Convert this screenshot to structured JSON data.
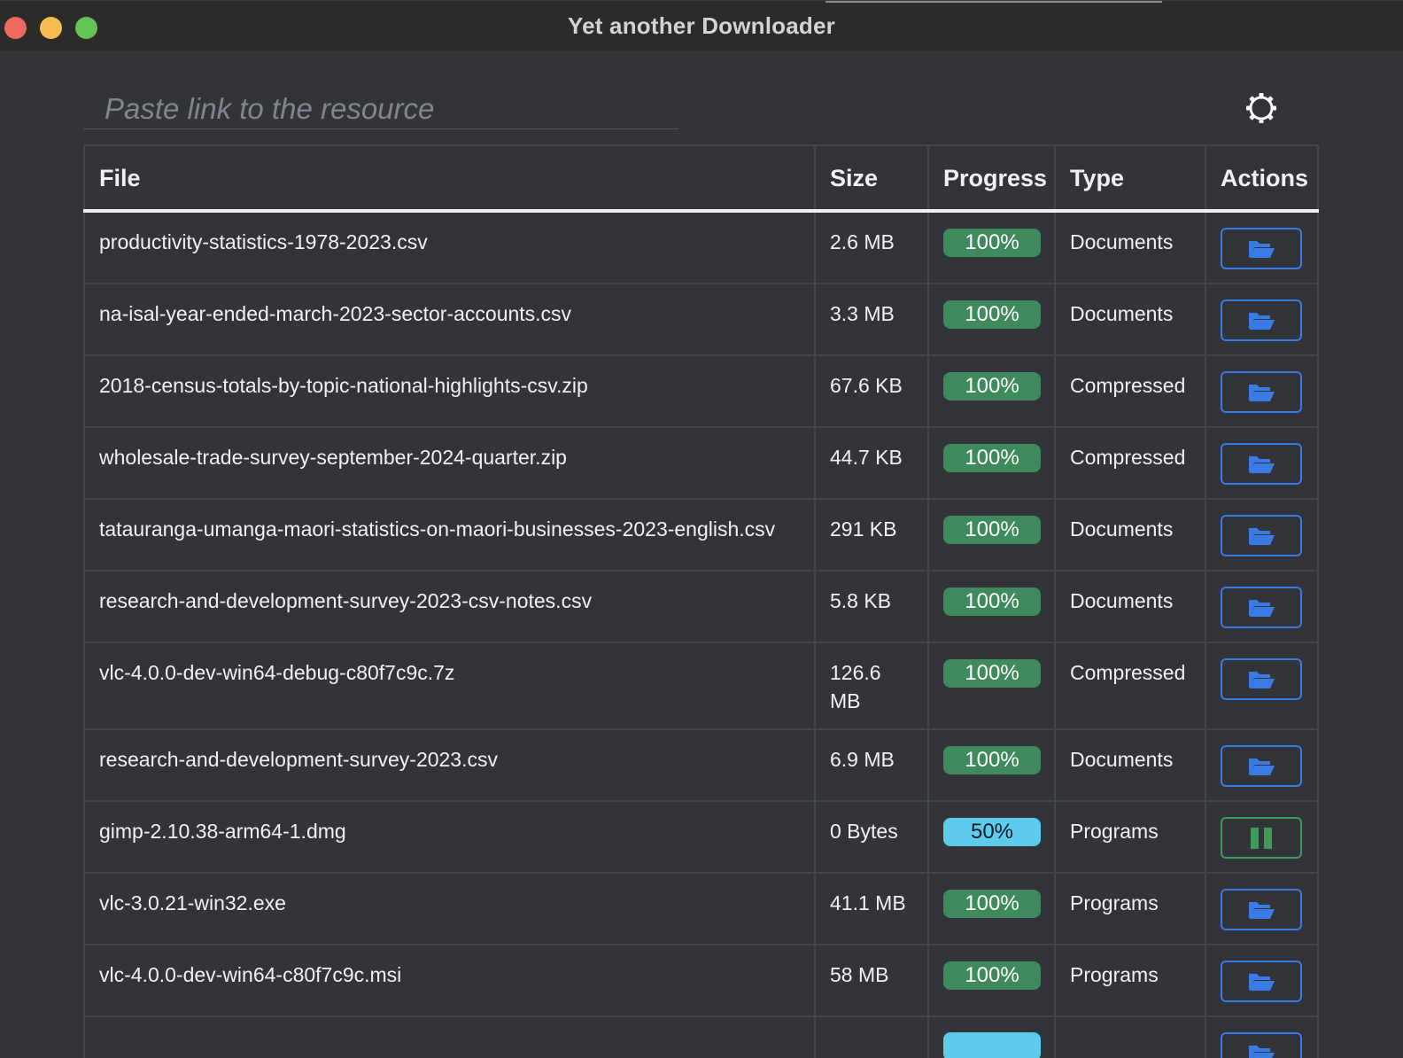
{
  "window": {
    "title": "Yet another Downloader"
  },
  "search": {
    "placeholder": "Paste link to the resource",
    "value": ""
  },
  "settings": {
    "icon": "gear-icon"
  },
  "table": {
    "columns": [
      "File",
      "Size",
      "Progress",
      "Type",
      "Actions"
    ],
    "rows": [
      {
        "file": "productivity-statistics-1978-2023.csv",
        "size": "2.6 MB",
        "progress": "100%",
        "type": "Documents",
        "action": "open-folder-icon"
      },
      {
        "file": "na-isal-year-ended-march-2023-sector-accounts.csv",
        "size": "3.3 MB",
        "progress": "100%",
        "type": "Documents",
        "action": "open-folder-icon"
      },
      {
        "file": "2018-census-totals-by-topic-national-highlights-csv.zip",
        "size": "67.6 KB",
        "progress": "100%",
        "type": "Compressed",
        "action": "open-folder-icon"
      },
      {
        "file": "wholesale-trade-survey-september-2024-quarter.zip",
        "size": "44.7 KB",
        "progress": "100%",
        "type": "Compressed",
        "action": "open-folder-icon"
      },
      {
        "file": "tatauranga-umanga-maori-statistics-on-maori-businesses-2023-english.csv",
        "size": "291 KB",
        "progress": "100%",
        "type": "Documents",
        "action": "open-folder-icon"
      },
      {
        "file": "research-and-development-survey-2023-csv-notes.csv",
        "size": "5.8 KB",
        "progress": "100%",
        "type": "Documents",
        "action": "open-folder-icon"
      },
      {
        "file": "vlc-4.0.0-dev-win64-debug-c80f7c9c.7z",
        "size": "126.6 MB",
        "progress": "100%",
        "type": "Compressed",
        "action": "open-folder-icon"
      },
      {
        "file": "research-and-development-survey-2023.csv",
        "size": "6.9 MB",
        "progress": "100%",
        "type": "Documents",
        "action": "open-folder-icon"
      },
      {
        "file": "gimp-2.10.38-arm64-1.dmg",
        "size": "0 Bytes",
        "progress": "50%",
        "type": "Programs",
        "action": "pause-icon"
      },
      {
        "file": "vlc-3.0.21-win32.exe",
        "size": "41.1 MB",
        "progress": "100%",
        "type": "Programs",
        "action": "open-folder-icon"
      },
      {
        "file": "vlc-4.0.0-dev-win64-c80f7c9c.msi",
        "size": "58 MB",
        "progress": "100%",
        "type": "Programs",
        "action": "open-folder-icon"
      },
      {
        "file": "",
        "size": "",
        "progress": "",
        "type": "",
        "action": "open-folder-icon"
      }
    ]
  },
  "colors": {
    "background": "#32343a",
    "titlebar": "#2b2b29",
    "complete_badge": "#3f8a5c",
    "partial_badge": "#5ccbec",
    "folder_accent": "#3b7be6",
    "pause_accent": "#3e9b5b"
  }
}
